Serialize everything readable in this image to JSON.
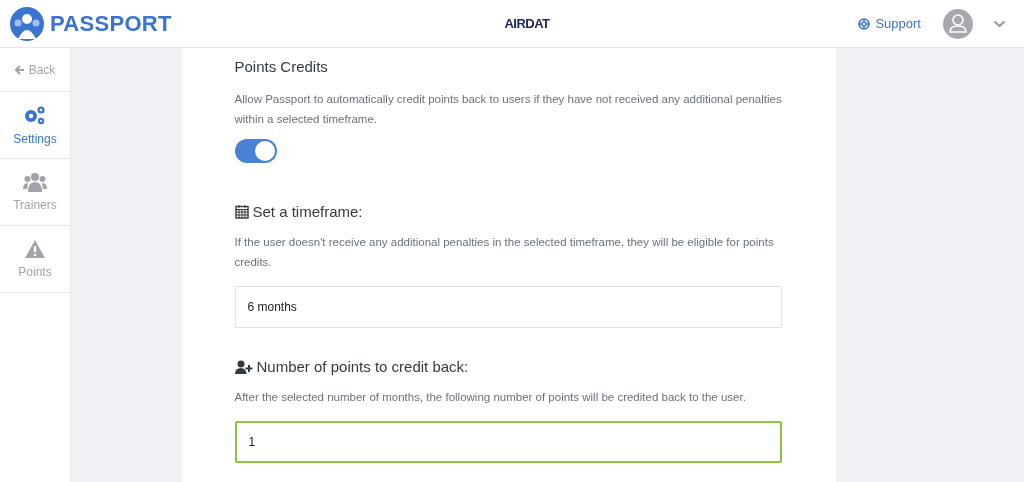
{
  "header": {
    "brand": "PASSPORT",
    "center_logo": "AIRDAT",
    "support_link": "Support"
  },
  "sidebar": {
    "items": [
      {
        "kind": "back",
        "label": "Back",
        "selected": false
      },
      {
        "kind": "gears",
        "label": "Settings",
        "selected": true
      },
      {
        "kind": "users",
        "label": "Trainers",
        "selected": false
      },
      {
        "kind": "warning",
        "label": "Points",
        "selected": false
      }
    ]
  },
  "settings": {
    "title": "Points Credits",
    "description": "Allow Passport to automatically credit points back to users if they have not received any additional penalties within a selected timeframe.",
    "toggle": {
      "on": true
    },
    "sections": [
      {
        "kind": "calendar",
        "heading": "Set a timeframe:",
        "help": "If the user doesn't receive any additional penalties in the selected timeframe, they will be eligible for points credits.",
        "value": "6 months",
        "focused": false
      },
      {
        "kind": "user-plus",
        "heading": "Number of points to credit back:",
        "help": "After the selected number of months, the following number of points will be credited back to the user.",
        "value": "1",
        "focused": true
      }
    ]
  }
}
